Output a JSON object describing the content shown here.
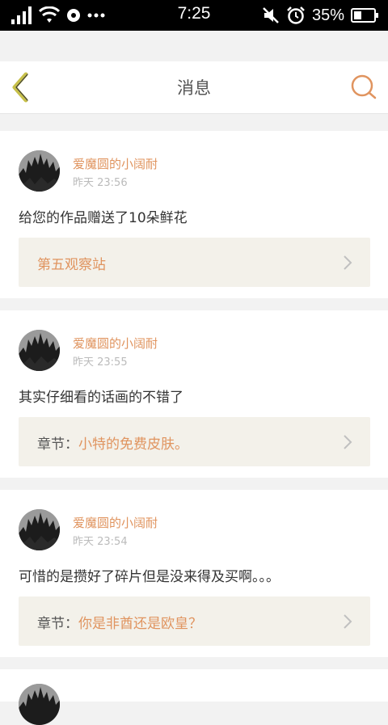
{
  "status_bar": {
    "time": "7:25",
    "battery": "35%",
    "icons": [
      "signal-icon",
      "wifi-icon",
      "notification-icon",
      "more-icon",
      "mute-icon",
      "alarm-icon",
      "battery-icon"
    ]
  },
  "header": {
    "title": "消息",
    "back_icon": "chevron-left-icon",
    "search_icon": "search-icon",
    "accent_color": "#e0945f",
    "back_color": "#c7c04a"
  },
  "messages": [
    {
      "user": "爱魔圆的小阔耐",
      "time": "昨天 23:56",
      "text": "给您的作品赠送了10朵鲜花",
      "ref_prefix": "",
      "ref_title": "第五观察站"
    },
    {
      "user": "爱魔圆的小阔耐",
      "time": "昨天 23:55",
      "text": "其实仔细看的话画的不错了",
      "ref_prefix": "章节：",
      "ref_title": "小特的免费皮肤。"
    },
    {
      "user": "爱魔圆的小阔耐",
      "time": "昨天 23:54",
      "text": "可惜的是攒好了碎片但是没来得及买啊。。。",
      "ref_prefix": "章节：",
      "ref_title": "你是非酋还是欧皇？"
    }
  ]
}
